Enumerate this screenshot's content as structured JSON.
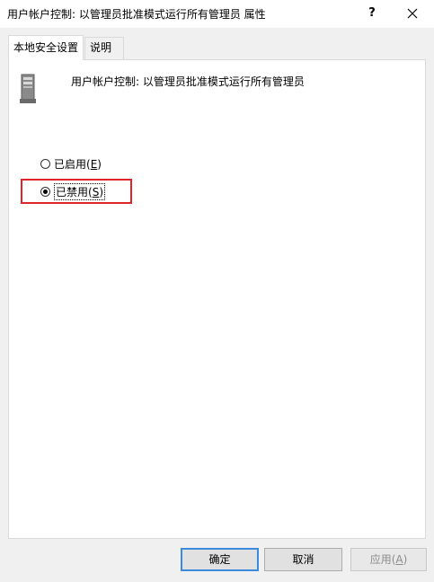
{
  "window": {
    "title": "用户帐户控制: 以管理员批准模式运行所有管理员 属性",
    "help_label": "?"
  },
  "tabs": [
    {
      "label": "本地安全设置",
      "active": true
    },
    {
      "label": "说明",
      "active": false
    }
  ],
  "policy": {
    "description": "用户帐户控制: 以管理员批准模式运行所有管理员",
    "icon": "server-icon"
  },
  "options": [
    {
      "label": "已启用(",
      "accel": "E",
      "tail": ")",
      "checked": false
    },
    {
      "label": "已禁用(",
      "accel": "S",
      "tail": ")",
      "checked": true
    }
  ],
  "buttons": {
    "ok": "确定",
    "cancel": "取消",
    "apply_pre": "应用(",
    "apply_accel": "A",
    "apply_post": ")"
  },
  "colors": {
    "highlight": "#e0242c",
    "default_button_border": "#3c8adb"
  }
}
